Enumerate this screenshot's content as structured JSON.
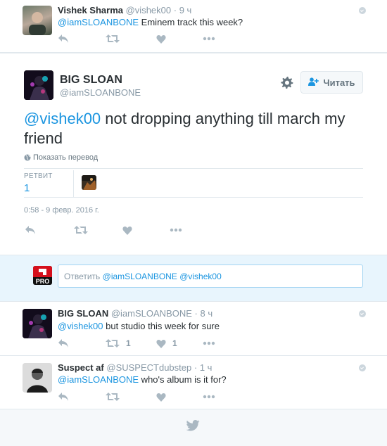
{
  "top_tweet": {
    "name": "Vishek Sharma",
    "handle": "@vishek00",
    "time": "9 ч",
    "mention": "@iamSLOANBONE",
    "text": " Eminem track this week?"
  },
  "main_tweet": {
    "name": "BIG SLOAN",
    "handle": "@iamSLOANBONE",
    "follow_label": "Читать",
    "mention": "@vishek00",
    "text": " not dropping anything till march my friend",
    "translate_label": "Показать перевод",
    "retweets_label": "РЕТВИТ",
    "retweets_count": "1",
    "timestamp": "0:58 - 9 февр. 2016 г."
  },
  "reply_box": {
    "prefix": "Ответить ",
    "mention1": "@iamSLOANBONE",
    "mention2": "@vishek00"
  },
  "replies": [
    {
      "name": "BIG SLOAN",
      "handle": "@iamSLOANBONE",
      "time": "8 ч",
      "mention": "@vishek00",
      "text": " but studio this week for sure",
      "retweets": "1",
      "likes": "1"
    },
    {
      "name": "Suspect af",
      "handle": "@SUSPECTdubstep",
      "time": "1 ч",
      "mention": "@iamSLOANBONE",
      "text": " who's album is it for?"
    }
  ],
  "colors": {
    "link": "#1b95e0",
    "muted": "#8899a6",
    "icon": "#aab8c2",
    "reply_bg": "#e8f5fd"
  }
}
